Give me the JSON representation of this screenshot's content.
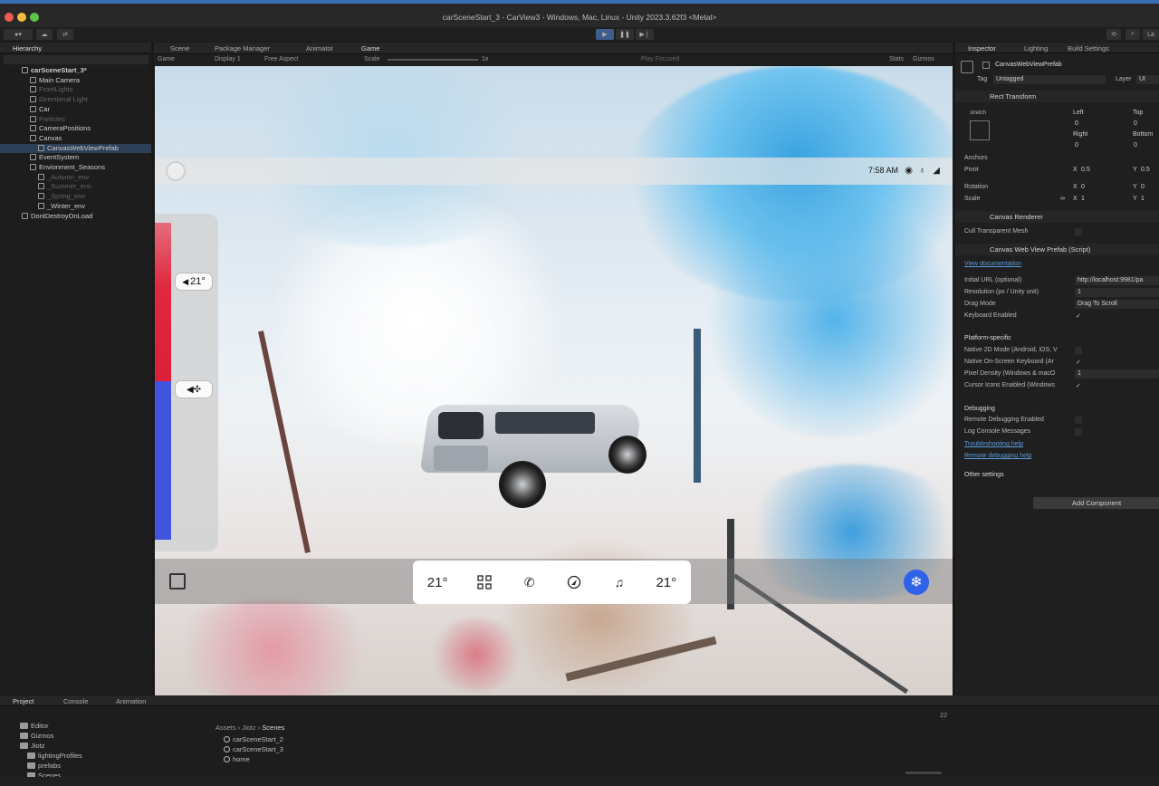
{
  "window": {
    "title": "carSceneStart_3 - CarView3 - Windows, Mac, Linux - Unity 2023.3.62f3 <Metal>"
  },
  "toolbar": {
    "play_icon": "play-icon",
    "pause_icon": "pause-icon",
    "step_icon": "step-icon"
  },
  "hierarchy": {
    "tab_label": "Hierarchy",
    "items": [
      {
        "label": "carSceneStart_3*",
        "indent": 0,
        "bold": true
      },
      {
        "label": "Main Camera",
        "indent": 1
      },
      {
        "label": "FrontLights",
        "indent": 1,
        "dim": true
      },
      {
        "label": "Directional Light",
        "indent": 1,
        "dim": true
      },
      {
        "label": "Car",
        "indent": 1
      },
      {
        "label": "Particles",
        "indent": 1,
        "dim": true
      },
      {
        "label": "CameraPositions",
        "indent": 1
      },
      {
        "label": "Canvas",
        "indent": 1
      },
      {
        "label": "CanvasWebViewPrefab",
        "indent": 2,
        "selected": true
      },
      {
        "label": "EventSystem",
        "indent": 1
      },
      {
        "label": "Envionment_Seasons",
        "indent": 1
      },
      {
        "label": "_Autumn_env",
        "indent": 2,
        "dim": true
      },
      {
        "label": "_Summer_env",
        "indent": 2,
        "dim": true
      },
      {
        "label": "_Spring_env",
        "indent": 2,
        "dim": true
      },
      {
        "label": "_Winter_env",
        "indent": 2
      },
      {
        "label": "DontDestroyOnLoad",
        "indent": 0
      }
    ]
  },
  "center_tabs": [
    "Scene",
    "Package Manager",
    "Animator",
    "Game"
  ],
  "game_bar": {
    "mode": "Game",
    "display": "Display 1",
    "aspect": "Free Aspect",
    "scale_label": "Scale",
    "scale_value": "1x",
    "play_focused": "Play Focused",
    "stats": "Stats",
    "gizmos": "Gizmos"
  },
  "car_ui": {
    "time": "7:58 AM",
    "left_temp": "21°",
    "dock_left_temp": "21°",
    "dock_right_temp": "21°",
    "icons": [
      "grid-icon",
      "phone-icon",
      "navigation-icon",
      "music-icon"
    ]
  },
  "inspector": {
    "tabs": [
      "Inspector",
      "Lighting",
      "Build Settings"
    ],
    "object_name": "CanvasWebViewPrefab",
    "tag_label": "Tag",
    "tag_value": "Untagged",
    "layer_label": "Layer",
    "layer_value": "UI",
    "rect_transform": "Rect Transform",
    "stretch": "stretch",
    "left": "Left",
    "top": "Top",
    "right": "Right",
    "bottom": "Bottom",
    "zero": "0",
    "anchors": "Anchors",
    "pivot": "Pivot",
    "pivot_x": "0.5",
    "pivot_y": "0.5",
    "rotation": "Rotation",
    "scale": "Scale",
    "one": "1",
    "x": "X",
    "y": "Y",
    "canvas_renderer": "Canvas Renderer",
    "cull_mesh": "Cull Transparent Mesh",
    "script_title": "Canvas Web View Prefab (Script)",
    "view_docs": "View documentation",
    "initial_url_label": "Initial URL (optional)",
    "initial_url_value": "http://localhost:9981/pa",
    "resolution_label": "Resolution (px / Unity unit)",
    "resolution_value": "1",
    "drag_mode_label": "Drag Mode",
    "drag_mode_value": "Drag To Scroll",
    "keyboard_label": "Keyboard Enabled",
    "platform_specific": "Platform-specific",
    "native2d": "Native 2D Mode (Android, iOS, V",
    "native_keyboard": "Native On-Screen Keyboard (Ar",
    "pixel_density": "Pixel Density (Windows & macO",
    "pixel_density_value": "1",
    "cursor_icons": "Cursor Icons Enabled (Windows",
    "debugging": "Debugging",
    "remote_debug": "Remote Debugging Enabled",
    "log_console": "Log Console Messages",
    "troubleshooting": "Troubleshooting help",
    "remote_debug_help": "Remote debugging help",
    "other_settings": "Other settings",
    "add_component": "Add Component"
  },
  "project": {
    "tabs": [
      "Project",
      "Console",
      "Animation"
    ],
    "tree": [
      "Editor",
      "Gizmos",
      "Jiotz",
      "lightingProfiles",
      "prefabs",
      "Scenes"
    ],
    "breadcrumb": [
      "Assets",
      "Jiotz",
      "Scenes"
    ],
    "files": [
      "carSceneStart_2",
      "carSceneStart_3",
      "home"
    ],
    "count": "22"
  },
  "colors": {
    "accent_blue": "#2f62e8",
    "heat_red": "#dd1f39",
    "cool_blue": "#4154df"
  }
}
